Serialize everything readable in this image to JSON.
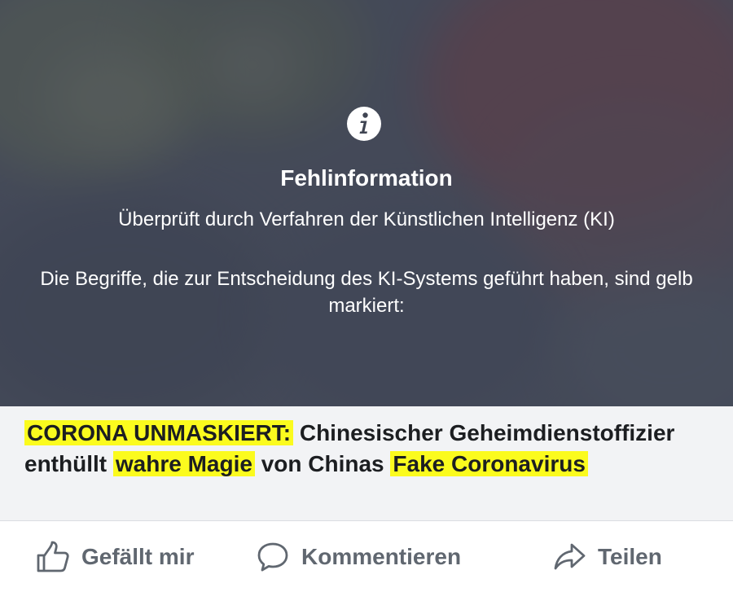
{
  "overlay": {
    "title": "Fehlinformation",
    "subtitle": "Überprüft durch Verfahren der Künstlichen Intelligenz (KI)",
    "explanation": "Die Begriffe, die zur Entscheidung des KI-Systems geführt haben, sind gelb markiert:",
    "icon": "info-icon"
  },
  "headline": {
    "segments": [
      {
        "text": "CORONA UNMASKIERT:",
        "highlight": true
      },
      {
        "text": " Chinesischer Geheimdienstoffizier enthüllt ",
        "highlight": false
      },
      {
        "text": "wahre Magie",
        "highlight": true
      },
      {
        "text": " von Chinas ",
        "highlight": false
      },
      {
        "text": "Fake Coronavirus",
        "highlight": true
      }
    ],
    "highlight_color": "#fbfb1e"
  },
  "actions": {
    "like": {
      "label": "Gefällt mir",
      "icon": "thumbs-up-icon"
    },
    "comment": {
      "label": "Kommentieren",
      "icon": "speech-bubble-icon"
    },
    "share": {
      "label": "Teilen",
      "icon": "share-arrow-icon"
    }
  },
  "colors": {
    "overlay_text": "#ffffff",
    "headline_bg": "#f2f3f5",
    "headline_text": "#1c1e21",
    "action_text": "#606770"
  }
}
